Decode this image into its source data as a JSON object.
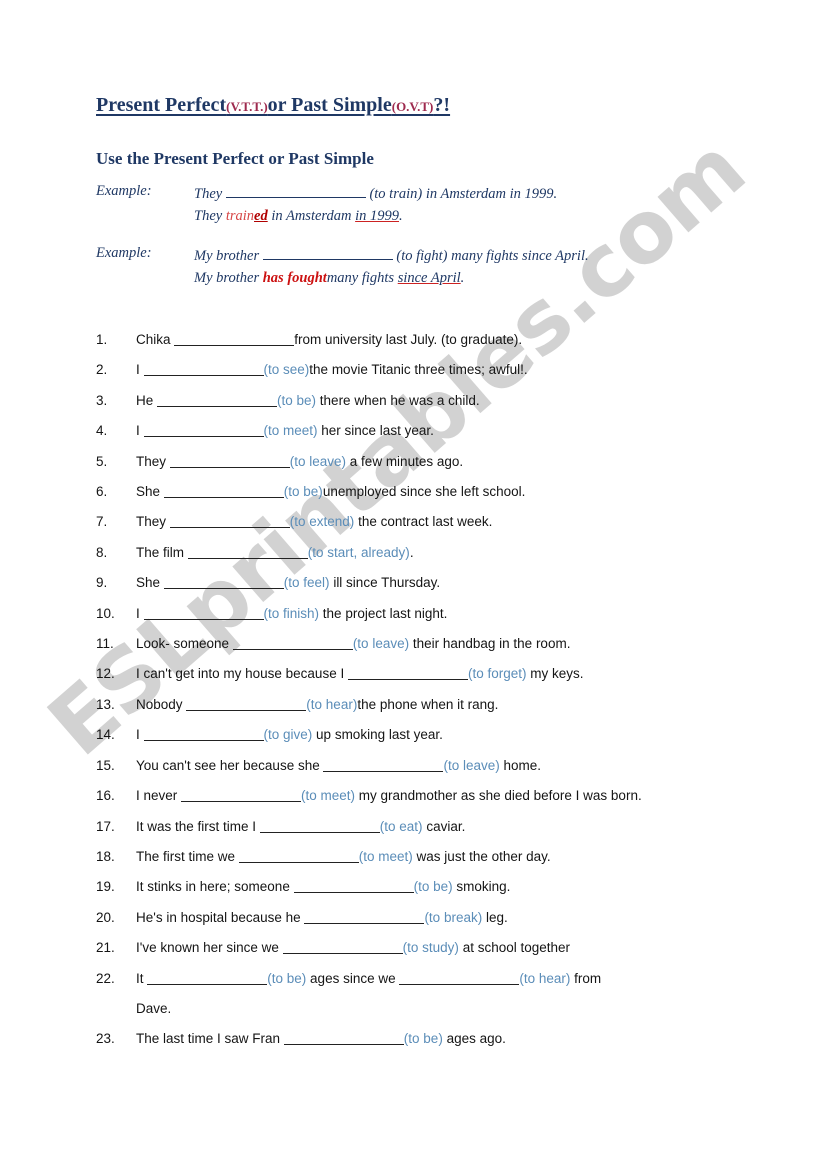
{
  "document": {
    "title_main_1": "Present Perfect",
    "title_sub_1": "(V.T.T.)",
    "title_mid": "or Past Simple",
    "title_sub_2": "(O.V.T)",
    "title_end": "?!",
    "subtitle": "Use the Present Perfect or Past Simple",
    "watermark": "ESLprintables.com"
  },
  "examples": [
    {
      "label": "Example:",
      "prompt_before": "They ",
      "prompt_blank": "",
      "prompt_after": " (to train) in Amsterdam in 1999.",
      "answer_before": "They ",
      "answer_light": "train",
      "answer_strong": "ed",
      "answer_mid": " in Amsterdam ",
      "answer_time": "in 1999",
      "answer_end": "."
    },
    {
      "label": "Example:",
      "prompt_before": "My brother ",
      "prompt_blank": "",
      "prompt_after": " (to fight) many fights since April.",
      "answer_before": "My brother ",
      "answer_light": "",
      "answer_strong": "",
      "answer_bold": "has fought",
      "answer_mid": "many fights ",
      "answer_time": "since April",
      "answer_end": "."
    }
  ],
  "exercises": [
    {
      "num": "1.",
      "before": "Chika ",
      "blank_w": 120,
      "verb": "",
      "after": "from university last July. (to graduate)."
    },
    {
      "num": "2.",
      "before": "I ",
      "blank_w": 120,
      "verb": "(to see)",
      "after": "the movie Titanic three times; awful!."
    },
    {
      "num": "3.",
      "before": "He ",
      "blank_w": 120,
      "verb": "(to be)",
      "after": " there when he was a child."
    },
    {
      "num": "4.",
      "before": "I ",
      "blank_w": 120,
      "verb": "(to meet)",
      "after": " her since last year."
    },
    {
      "num": "5.",
      "before": "They ",
      "blank_w": 120,
      "verb": "(to leave)",
      "after": " a few minutes ago."
    },
    {
      "num": "6.",
      "before": "She ",
      "blank_w": 120,
      "verb": "(to be)",
      "after": "unemployed since she left school."
    },
    {
      "num": "7.",
      "before": "They ",
      "blank_w": 120,
      "verb": "(to extend)",
      "after": " the contract last week."
    },
    {
      "num": "8.",
      "before": "The film ",
      "blank_w": 120,
      "verb": "(to start, already)",
      "after": "."
    },
    {
      "num": "9.",
      "before": "She ",
      "blank_w": 120,
      "verb": "(to feel)",
      "after": " ill since Thursday."
    },
    {
      "num": "10.",
      "before": "I ",
      "blank_w": 120,
      "verb": "(to finish)",
      "after": " the project last night."
    },
    {
      "num": "11.",
      "before": "Look- someone ",
      "blank_w": 120,
      "verb": "(to leave)",
      "after": " their handbag in the room."
    },
    {
      "num": "12.",
      "before": "I can't get into my house because I ",
      "blank_w": 120,
      "verb": "(to forget)",
      "after": " my keys."
    },
    {
      "num": "13.",
      "before": "Nobody ",
      "blank_w": 120,
      "verb": "(to hear)",
      "after": "the phone when it rang."
    },
    {
      "num": "14.",
      "before": "I ",
      "blank_w": 120,
      "verb": "(to give)",
      "after": " up smoking last year."
    },
    {
      "num": "15.",
      "before": "You can't see her because she ",
      "blank_w": 120,
      "verb": "(to leave)",
      "after": " home."
    },
    {
      "num": "16.",
      "before": "I never ",
      "blank_w": 120,
      "verb": "(to meet)",
      "after": " my grandmother as she died before I was born."
    },
    {
      "num": "17.",
      "before": "It was the first time I ",
      "blank_w": 120,
      "verb": "(to eat)",
      "after": " caviar."
    },
    {
      "num": "18.",
      "before": "The first time we ",
      "blank_w": 120,
      "verb": "(to meet)",
      "after": " was just the other day."
    },
    {
      "num": "19.",
      "before": "It stinks in here; someone ",
      "blank_w": 120,
      "verb": "(to be)",
      "after": " smoking."
    },
    {
      "num": "20.",
      "before": "He's in hospital because he ",
      "blank_w": 120,
      "verb": "(to break)",
      "after": " leg."
    },
    {
      "num": "21.",
      "before": "I've known her since we ",
      "blank_w": 120,
      "verb": "(to study)",
      "after": " at school together"
    },
    {
      "num": "22.",
      "before": "It ",
      "blank_w": 120,
      "verb": "(to be)",
      "after": " ages since we ",
      "blank2_w": 120,
      "verb2": "(to hear)",
      "after2": " from",
      "continuation": "Dave."
    },
    {
      "num": "23.",
      "before": "The last time I saw Fran ",
      "blank_w": 120,
      "verb": "(to be)",
      "after": " ages ago."
    }
  ]
}
